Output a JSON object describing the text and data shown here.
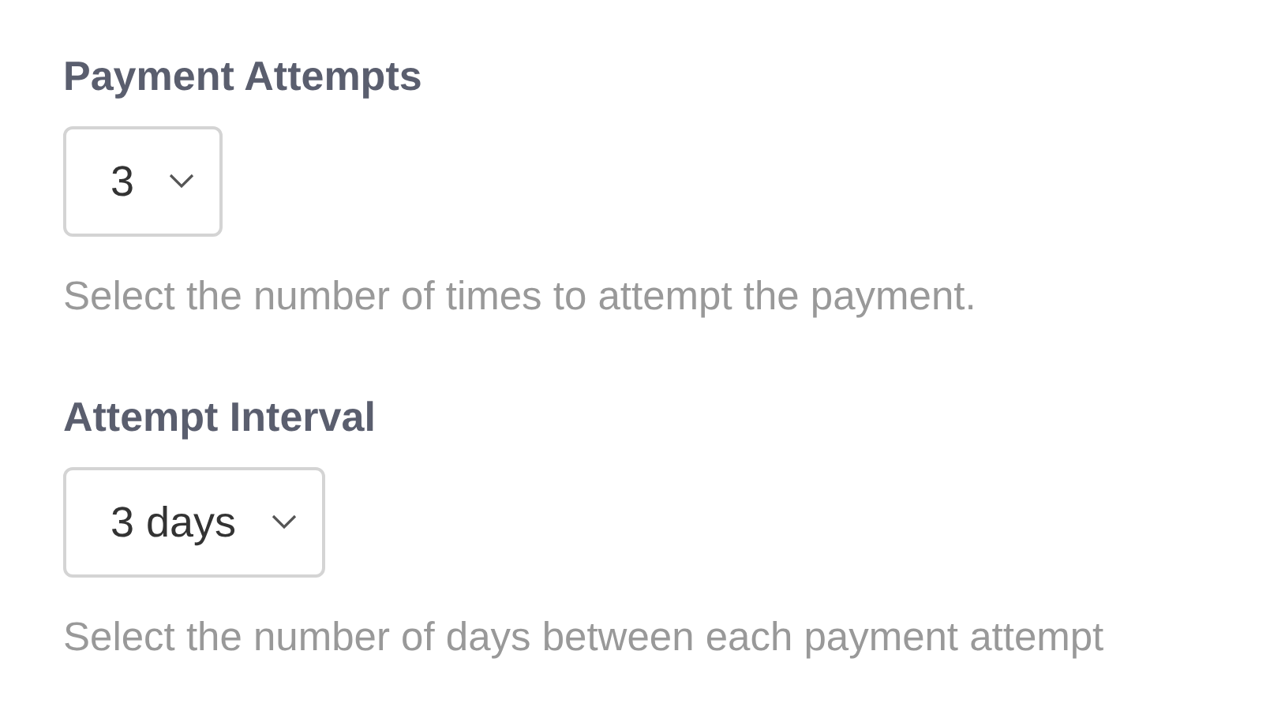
{
  "fields": [
    {
      "label": "Payment Attempts",
      "value": "3",
      "help": "Select the number of times to attempt the payment."
    },
    {
      "label": "Attempt Interval",
      "value": "3 days",
      "help": "Select the number of days between each payment attempt"
    }
  ]
}
